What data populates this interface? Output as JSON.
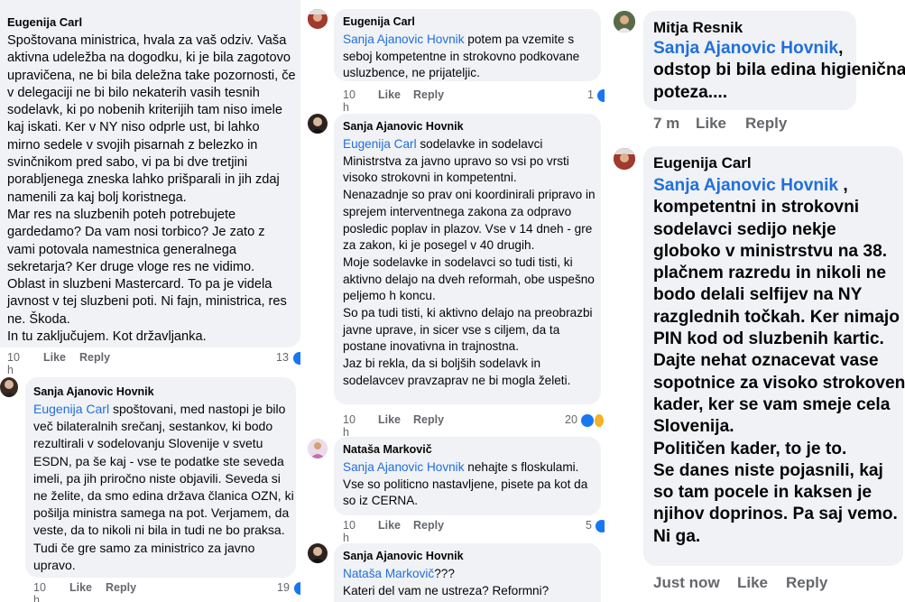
{
  "col1": {
    "c1": {
      "author": "Eugenija Carl",
      "body": "Spoštovana ministrica, hvala za vaš odziv. Vaša aktivna udeležba na dogodku, ki je bila zagotovo upravičena, ne bi bila deležna take pozornosti, če v delegaciji ne bi bilo nekaterih vasih tesnih sodelavk, ki po nobenih kriterijih tam niso imele kaj iskati. Ker v NY niso odprle ust, bi lahko mirno sedele v svojih pisarnah z belezko in svinčnikom pred sabo, vi pa bi dve tretjini porabljenega zneska lahko prišparali in jih zdaj namenili za kaj bolj koristnega.\nMar res na sluzbenih poteh potrebujete gardedamo? Da vam nosi torbico? Je zato z vami potovala namestnica generalnega sekretarja? Ker druge vloge res ne vidimo.\nOblast in sluzbeni Mastercard. To pa je videla javnost v tej sluzbeni poti. Ni fajn, ministrica, res ne. Škoda.\nIn tu zaključujem. Kot državljanka.",
      "time": "10 h",
      "like": "Like",
      "reply": "Reply",
      "reactions": "13"
    },
    "c2": {
      "author": "Sanja Ajanovic Hovnik",
      "mention": "Eugenija Carl",
      "body": " spoštovani, med nastopi je bilo več bilateralnih srečanj, sestankov, ki bodo rezultirali v sodelovanju Slovenije v svetu ESDN, pa še kaj - vse te podatke ste seveda imeli, pa jih priročno niste objavili. Seveda si ne želite, da smo edina država članica OZN, ki pošilja ministra samega na pot. Verjamem, da veste, da to nikoli ni bila in tudi ne bo praksa. Tudi če gre samo za ministrico za javno upravo.",
      "time": "10 h",
      "like": "Like",
      "reply": "Reply",
      "reactions": "19"
    }
  },
  "col2": {
    "c3": {
      "author": "Eugenija Carl",
      "mention": "Sanja Ajanovic Hovnik",
      "body": " potem pa vzemite s seboj kompetentne in strokovno podkovane usluzbence, ne prijateljic.",
      "time": "10 h",
      "like": "Like",
      "reply": "Reply",
      "reactions": "1"
    },
    "c4": {
      "author": "Sanja Ajanovic Hovnik",
      "mention": "Eugenija Carl",
      "body": " sodelavke in sodelavci Ministrstva za javno upravo so vsi po vrsti visoko strokovni in kompetentni.\nNenazadnje so prav oni koordinirali pripravo in sprejem interventnega zakona za odpravo posledic poplav in plazov. Vse v 14 dneh - gre za zakon, ki je posegel v 40 drugih.\nMoje sodelavke in sodelavci so tudi tisti, ki aktivno delajo na dveh reformah, obe uspešno peljemo h koncu.\nSo pa tudi tisti, ki aktivno delajo na preobrazbi javne uprave, in sicer vse s ciljem, da ta postane inovativna in trajnostna.\nJaz bi rekla, da si boljših sodelavk in sodelavcev pravzaprav ne bi mogla želeti.",
      "time": "10 h",
      "like": "Like",
      "reply": "Reply",
      "reactions": "20"
    },
    "c5": {
      "author": "Nataša Markovič",
      "mention": "Sanja Ajanovic Hovnik",
      "body": " nehajte s floskulami. Vse so politicno nastavljene, pisete pa kot da so iz CERNA.",
      "time": "10 h",
      "like": "Like",
      "reply": "Reply",
      "reactions": "5"
    },
    "c6": {
      "author": "Sanja Ajanovic Hovnik",
      "mention": "Nataša Markovič",
      "body": "???\nKateri del vam ne ustreza? Reformni?"
    }
  },
  "col3": {
    "c7": {
      "author": "Mitja Resnik",
      "mention": "Sanja Ajanovic Hovnik",
      "body": ",\nodstop bi bila edina higienična poteza....",
      "time": "7 m",
      "like": "Like",
      "reply": "Reply"
    },
    "c8": {
      "author": "Eugenija Carl",
      "mention": "Sanja Ajanovic Hovnik",
      "body": " , kompetentni in strokovni sodelavci sedijo nekje globoko v ministrstvu na 38. plačnem razredu in nikoli ne bodo delali selfijev  na NY razglednih točkah. Ker nimajo PIN kod od sluzbenih kartic.\nDajte nehat oznacevat vase sopotnice za visoko strokoven kader, ker se vam smeje cela Slovenija.\nPolitičen kader, to je to.\nSe danes niste pojasnili, kaj so tam pocele in kaksen  je njihov doprinos. Pa saj vemo.\nNi ga.",
      "time": "Just now",
      "like": "Like",
      "reply": "Reply"
    }
  },
  "colors": {
    "bubble": "#f0f2f5",
    "mention": "#216fdb",
    "meta": "#65676b",
    "like_blue": "#1877f2"
  }
}
